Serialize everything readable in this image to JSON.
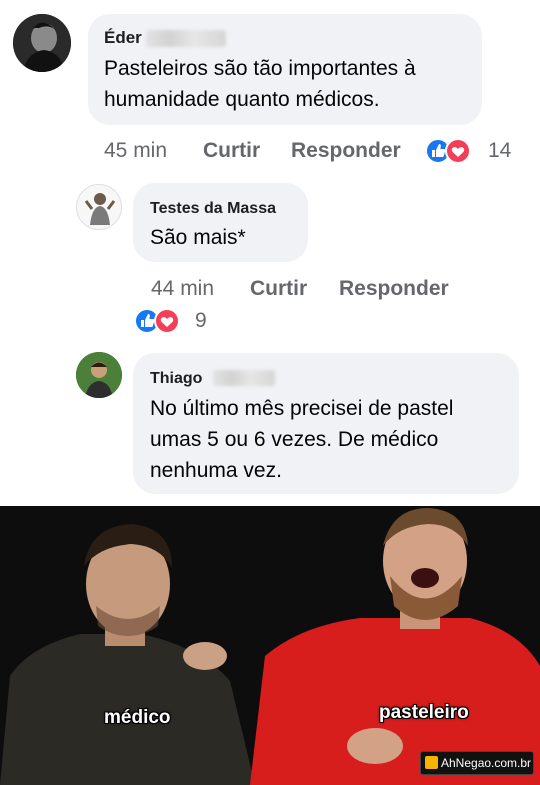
{
  "comments": [
    {
      "author": "Éder",
      "text_lines": [
        "Pasteleiros são tão importantes à",
        "humanidade quanto médicos."
      ],
      "time": "45 min",
      "like_label": "Curtir",
      "reply_label": "Responder",
      "reactions_count": "14"
    },
    {
      "author": "Testes da Massa",
      "text_lines": [
        "São mais*"
      ],
      "time": "44 min",
      "like_label": "Curtir",
      "reply_label": "Responder",
      "reactions_count": "9"
    },
    {
      "author": "Thiago",
      "text_lines": [
        "No último mês precisei de pastel",
        "umas 5 ou 6 vezes. De médico",
        "nenhuma vez."
      ]
    }
  ],
  "meme": {
    "left_label": "médico",
    "right_label": "pasteleiro",
    "watermark": "AhNegao.com.br"
  },
  "colors": {
    "bubble": "#f0f2f5",
    "like_blue": "#1877f2",
    "love_red": "#f33e58",
    "meta_gray": "#65676b"
  },
  "icons": [
    "like-icon",
    "love-icon"
  ]
}
